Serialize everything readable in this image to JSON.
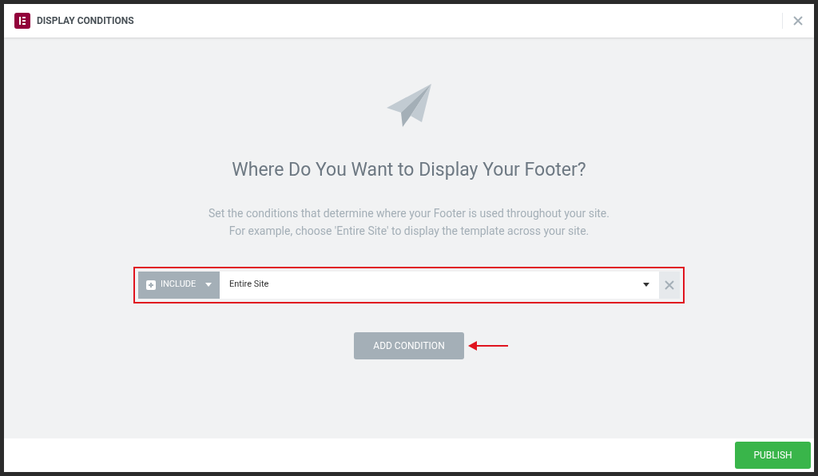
{
  "dialog": {
    "title": "DISPLAY CONDITIONS"
  },
  "heading": "Where Do You Want to Display Your Footer?",
  "description": [
    "Set the conditions that determine where your Footer is used throughout your site.",
    "For example, choose 'Entire Site' to display the template across your site."
  ],
  "conditions": [
    {
      "type": "INCLUDE",
      "value": "Entire Site"
    }
  ],
  "add_button": "ADD CONDITION",
  "publish_button": "PUBLISH"
}
